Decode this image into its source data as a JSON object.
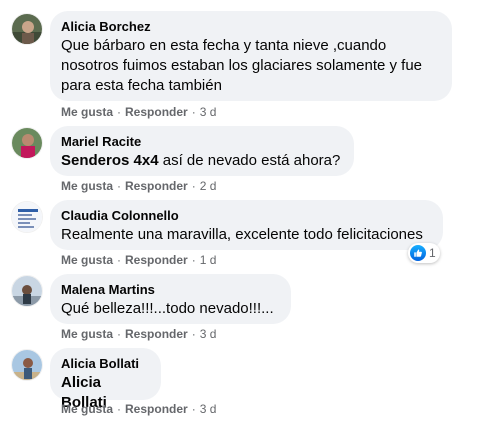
{
  "actions": {
    "like": "Me gusta",
    "reply": "Responder",
    "separator": "·"
  },
  "comments": [
    {
      "author": "Alicia Borchez",
      "lines": [
        "Que bárbaro en esta fecha y tanta nieve ,cuando",
        "nosotros fuimos estaban los glaciares solamente y fue",
        "para esta fecha también"
      ],
      "time": "3 d"
    },
    {
      "author": "Mariel Racite",
      "tag": "Senderos 4x4",
      "text_after_tag": " así de nevado está ahora?",
      "time": "2 d"
    },
    {
      "author": "Claudia Colonnello",
      "text": "Realmente una maravilla, excelente todo felicitaciones",
      "time": "1 d",
      "reaction_icon": "like-icon",
      "reaction_count": "1"
    },
    {
      "author": "Malena Martins",
      "text": "Qué belleza!!!...todo nevado!!!...",
      "time": "3 d"
    },
    {
      "author": "Alicia Bollati",
      "tag": "Alicia Bollati",
      "time": "3 d"
    }
  ],
  "colors": {
    "bubble": "#f0f2f5",
    "meta": "#65676b",
    "like_blue": "#0866ff"
  }
}
